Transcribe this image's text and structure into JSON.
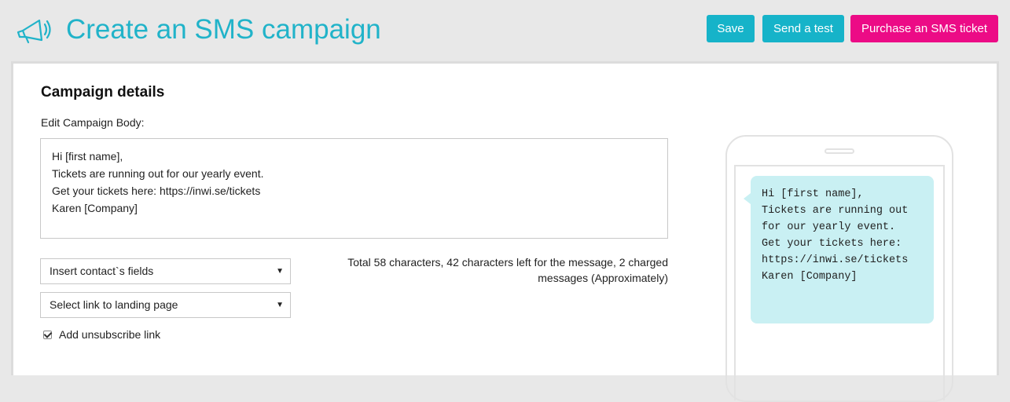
{
  "header": {
    "title": "Create an SMS campaign",
    "save_label": "Save",
    "test_label": "Send a test",
    "purchase_label": "Purchase an SMS ticket"
  },
  "campaign": {
    "section_title": "Campaign details",
    "body_label": "Edit Campaign Body:",
    "body_lines": [
      "Hi [first name],",
      "Tickets are running out for our yearly event.",
      "Get your tickets here: https://inwi.se/tickets",
      "Karen [Company]"
    ],
    "insert_fields": "Insert contact`s fields",
    "landing_link": "Select link to landing page",
    "unsubscribe_label": "Add unsubscribe link",
    "unsubscribe_checked": true,
    "counter_text": "Total  58 characters,  42 characters left for the message,  2 charged messages (Approximately)"
  },
  "preview": {
    "lines": [
      "Hi [first name],",
      "Tickets are running out",
      "for our yearly event.",
      "Get your tickets here:",
      "https://inwi.se/tickets",
      "Karen [Company]"
    ]
  },
  "icons": {
    "header": "megaphone-icon",
    "dropdown": "caret-down-icon",
    "checkbox": "checkbox-checked-icon"
  },
  "colors": {
    "accent": "#16b3c9",
    "title": "#21b3c9",
    "purchase": "#ec0b86",
    "bubble": "#c9f0f3"
  }
}
